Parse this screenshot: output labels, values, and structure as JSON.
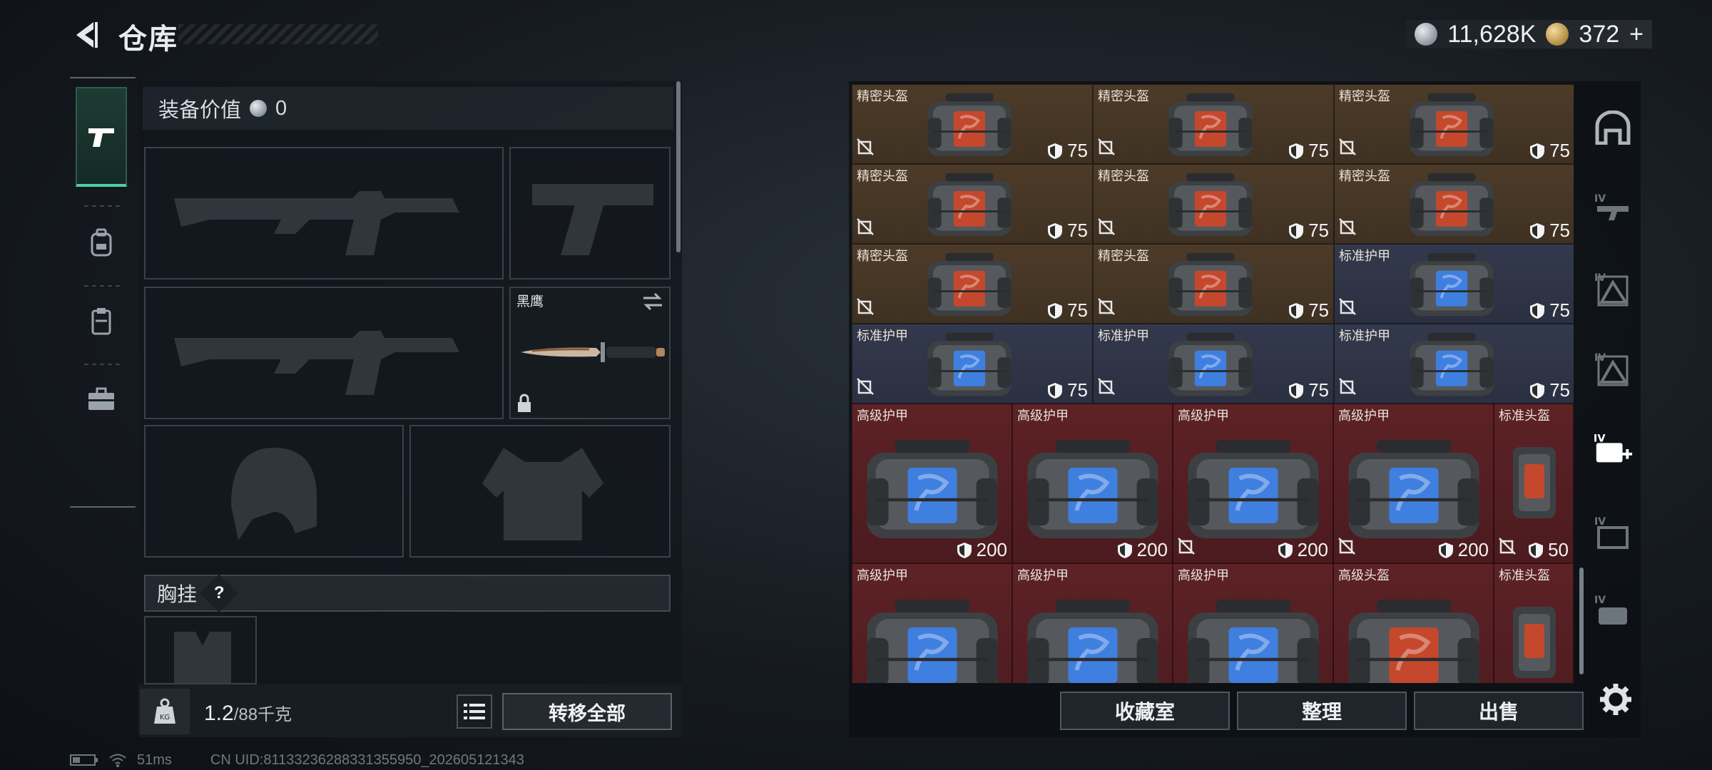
{
  "header": {
    "title": "仓库",
    "currency_silver": "11,628K",
    "currency_gold": "372",
    "gold_plus": "+"
  },
  "left_tabs": [
    {
      "icon": "pistol-icon",
      "active": true
    },
    {
      "icon": "backpack-icon",
      "active": false
    },
    {
      "icon": "chest-rig-icon",
      "active": false
    },
    {
      "icon": "briefcase-icon",
      "active": false
    }
  ],
  "loadout": {
    "equip_value_label": "装备价值",
    "equip_value": "0",
    "melee_name": "黑鹰",
    "chest_rig_label": "胸挂",
    "help_glyph": "?",
    "weight_current": "1.2",
    "weight_max": "/88千克",
    "transfer_all": "转移全部"
  },
  "inventory": {
    "rows": [
      {
        "cells": [
          {
            "name": "精密头盔",
            "dur": "75",
            "color": "brown",
            "tint": "#c5482c"
          },
          {
            "name": "精密头盔",
            "dur": "75",
            "color": "brown",
            "tint": "#c5482c"
          },
          {
            "name": "精密头盔",
            "dur": "75",
            "color": "brown",
            "tint": "#c5482c"
          }
        ]
      },
      {
        "cells": [
          {
            "name": "精密头盔",
            "dur": "75",
            "color": "brown",
            "tint": "#c5482c"
          },
          {
            "name": "精密头盔",
            "dur": "75",
            "color": "brown",
            "tint": "#c5482c"
          },
          {
            "name": "精密头盔",
            "dur": "75",
            "color": "brown",
            "tint": "#c5482c"
          }
        ]
      },
      {
        "cells": [
          {
            "name": "精密头盔",
            "dur": "75",
            "color": "brown",
            "tint": "#c5482c"
          },
          {
            "name": "精密头盔",
            "dur": "75",
            "color": "brown",
            "tint": "#c5482c"
          },
          {
            "name": "标准护甲",
            "dur": "75",
            "color": "slate",
            "tint": "#3f7fe0"
          }
        ]
      },
      {
        "cells": [
          {
            "name": "标准护甲",
            "dur": "75",
            "color": "slate",
            "tint": "#3f7fe0"
          },
          {
            "name": "标准护甲",
            "dur": "75",
            "color": "slate",
            "tint": "#3f7fe0"
          },
          {
            "name": "标准护甲",
            "dur": "75",
            "color": "slate",
            "tint": "#3f7fe0"
          }
        ]
      }
    ],
    "big_rows": [
      {
        "cells": [
          {
            "name": "高级护甲",
            "dur": "200",
            "nodrop": false,
            "tint": "#3f7fe0"
          },
          {
            "name": "高级护甲",
            "dur": "200",
            "nodrop": false,
            "tint": "#3f7fe0"
          },
          {
            "name": "高级护甲",
            "dur": "200",
            "nodrop": true,
            "tint": "#3f7fe0"
          },
          {
            "name": "高级护甲",
            "dur": "200",
            "nodrop": true,
            "tint": "#3f7fe0"
          }
        ],
        "side": {
          "name": "标准头盔",
          "dur": "50"
        }
      },
      {
        "cells": [
          {
            "name": "高级护甲",
            "dur": "",
            "nodrop": false,
            "tint": "#3f7fe0"
          },
          {
            "name": "高级护甲",
            "dur": "",
            "nodrop": false,
            "tint": "#3f7fe0"
          },
          {
            "name": "高级护甲",
            "dur": "",
            "nodrop": false,
            "tint": "#3f7fe0"
          },
          {
            "name": "高级头盔",
            "dur": "",
            "nodrop": false,
            "tint": "#c5482c"
          }
        ],
        "side": {
          "name": "标准头盔",
          "dur": ""
        }
      }
    ],
    "buttons": {
      "collection": "收藏室",
      "organize": "整理",
      "sell": "出售"
    }
  },
  "status": {
    "ping": "51ms",
    "uid": "CN UID:811332362883313559​50_202605121343"
  },
  "colors": {
    "accent_green": "#4fd1a0",
    "cell_brown": "#4d3b29",
    "cell_slate": "#33394c",
    "cell_red": "#5d2226"
  }
}
